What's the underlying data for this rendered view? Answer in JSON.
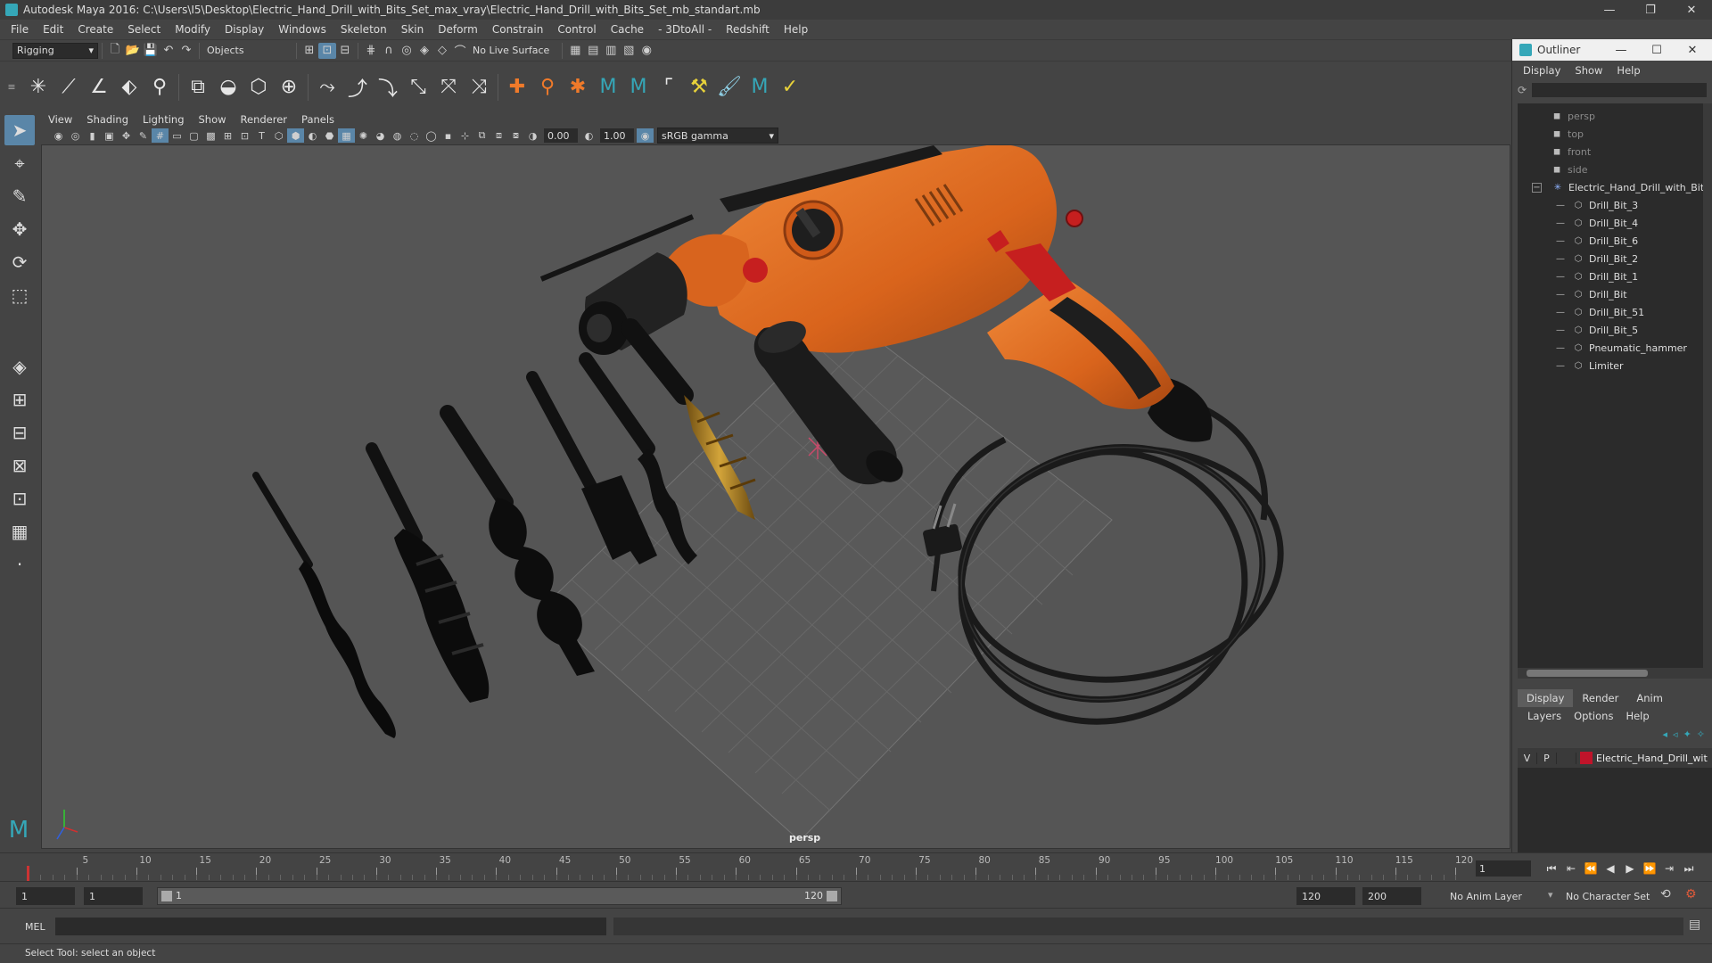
{
  "window": {
    "title": "Autodesk Maya 2016: C:\\Users\\I5\\Desktop\\Electric_Hand_Drill_with_Bits_Set_max_vray\\Electric_Hand_Drill_with_Bits_Set_mb_standart.mb",
    "minimize": "—",
    "restore": "❐",
    "close": "✕"
  },
  "menubar": [
    "File",
    "Edit",
    "Create",
    "Select",
    "Modify",
    "Display",
    "Windows",
    "Skeleton",
    "Skin",
    "Deform",
    "Constrain",
    "Control",
    "Cache",
    "- 3DtoAll -",
    "Redshift",
    "Help"
  ],
  "statusline": {
    "mode": "Rigging",
    "select_mode": "Objects",
    "live_surface": "No Live Surface"
  },
  "viewport": {
    "menu": [
      "View",
      "Shading",
      "Lighting",
      "Show",
      "Renderer",
      "Panels"
    ],
    "exposure": "0.00",
    "gamma": "1.00",
    "color_space": "sRGB gamma",
    "camera_label": "persp"
  },
  "outliner": {
    "title": "Outliner",
    "menu": [
      "Display",
      "Show",
      "Help"
    ],
    "cameras": [
      "persp",
      "top",
      "front",
      "side"
    ],
    "group": "Electric_Hand_Drill_with_Bits",
    "children": [
      "Drill_Bit_3",
      "Drill_Bit_4",
      "Drill_Bit_6",
      "Drill_Bit_2",
      "Drill_Bit_1",
      "Drill_Bit",
      "Drill_Bit_51",
      "Drill_Bit_5",
      "Pneumatic_hammer",
      "Limiter"
    ]
  },
  "layers": {
    "tabs": [
      "Display",
      "Render",
      "Anim"
    ],
    "menu": [
      "Layers",
      "Options",
      "Help"
    ],
    "row": {
      "v": "V",
      "p": "P",
      "name": "Electric_Hand_Drill_wit",
      "color": "#c0142a"
    }
  },
  "timeslider": {
    "ticks": [
      "1",
      "5",
      "10",
      "15",
      "20",
      "25",
      "30",
      "35",
      "40",
      "45",
      "50",
      "55",
      "60",
      "65",
      "70",
      "75",
      "80",
      "85",
      "90",
      "95",
      "100",
      "105",
      "110",
      "115",
      "120"
    ],
    "current_frame": "1"
  },
  "rangeslider": {
    "start": "1",
    "playback_start": "1",
    "range_start_label": "1",
    "range_end_label": "120",
    "playback_end": "120",
    "end": "200",
    "anim_layer": "No Anim Layer",
    "character_set": "No Character Set"
  },
  "cmdline": {
    "label": "MEL"
  },
  "helpline": {
    "text": "Select Tool: select an object"
  },
  "colors": {
    "accent": "#5a86a8",
    "drill_orange": "#e2691e",
    "maya_teal": "#35a7b8"
  }
}
